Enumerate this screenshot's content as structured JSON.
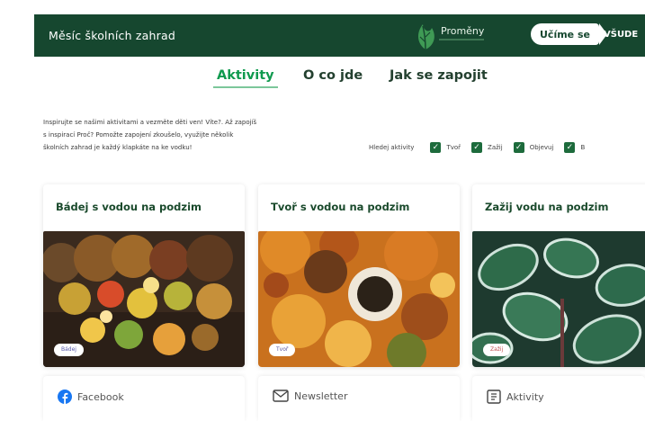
{
  "header": {
    "site_title": "Měsíc školních zahrad",
    "logo_name": "Proměny",
    "ucime_label": "Učíme se",
    "vsude_label": "VŠUDE"
  },
  "tabs": [
    {
      "label": "Aktivity",
      "active": true
    },
    {
      "label": "O co jde",
      "active": false
    },
    {
      "label": "Jak se zapojit",
      "active": false
    }
  ],
  "intro": {
    "lines": [
      "Inspirujte se našimi aktivitami a vezměte děti ven! Víte?. Až zapojíš",
      "s inspirací Proč? Pomožte zapojení zkoušelo, využijte několik",
      "školních zahrad je každý klapkáte na ke vodku!"
    ]
  },
  "filters": {
    "label": "Hledej aktivity",
    "options": [
      "Tvoř",
      "Zažij",
      "Objevuj",
      "B"
    ]
  },
  "cards": [
    {
      "title": "Bádej s vodou na podzim",
      "badge": "Bádej",
      "badge_color": "#b3b8e8"
    },
    {
      "title": "Tvoř s vodou na podzim",
      "badge": "Tvoř",
      "badge_color": "#a9a5d8"
    },
    {
      "title": "Zažij vodu na podzim",
      "badge": "Zažij",
      "badge_color": "#f0a2a2"
    }
  ],
  "bottom": [
    {
      "label": "Facebook",
      "icon": "facebook-icon"
    },
    {
      "label": "Newsletter",
      "icon": "mail-icon"
    },
    {
      "label": "Aktivity",
      "icon": "grid-icon"
    }
  ],
  "colors": {
    "header_bg": "#16472f",
    "accent": "#0f9a4e",
    "checkbox": "#1d6b3c"
  }
}
